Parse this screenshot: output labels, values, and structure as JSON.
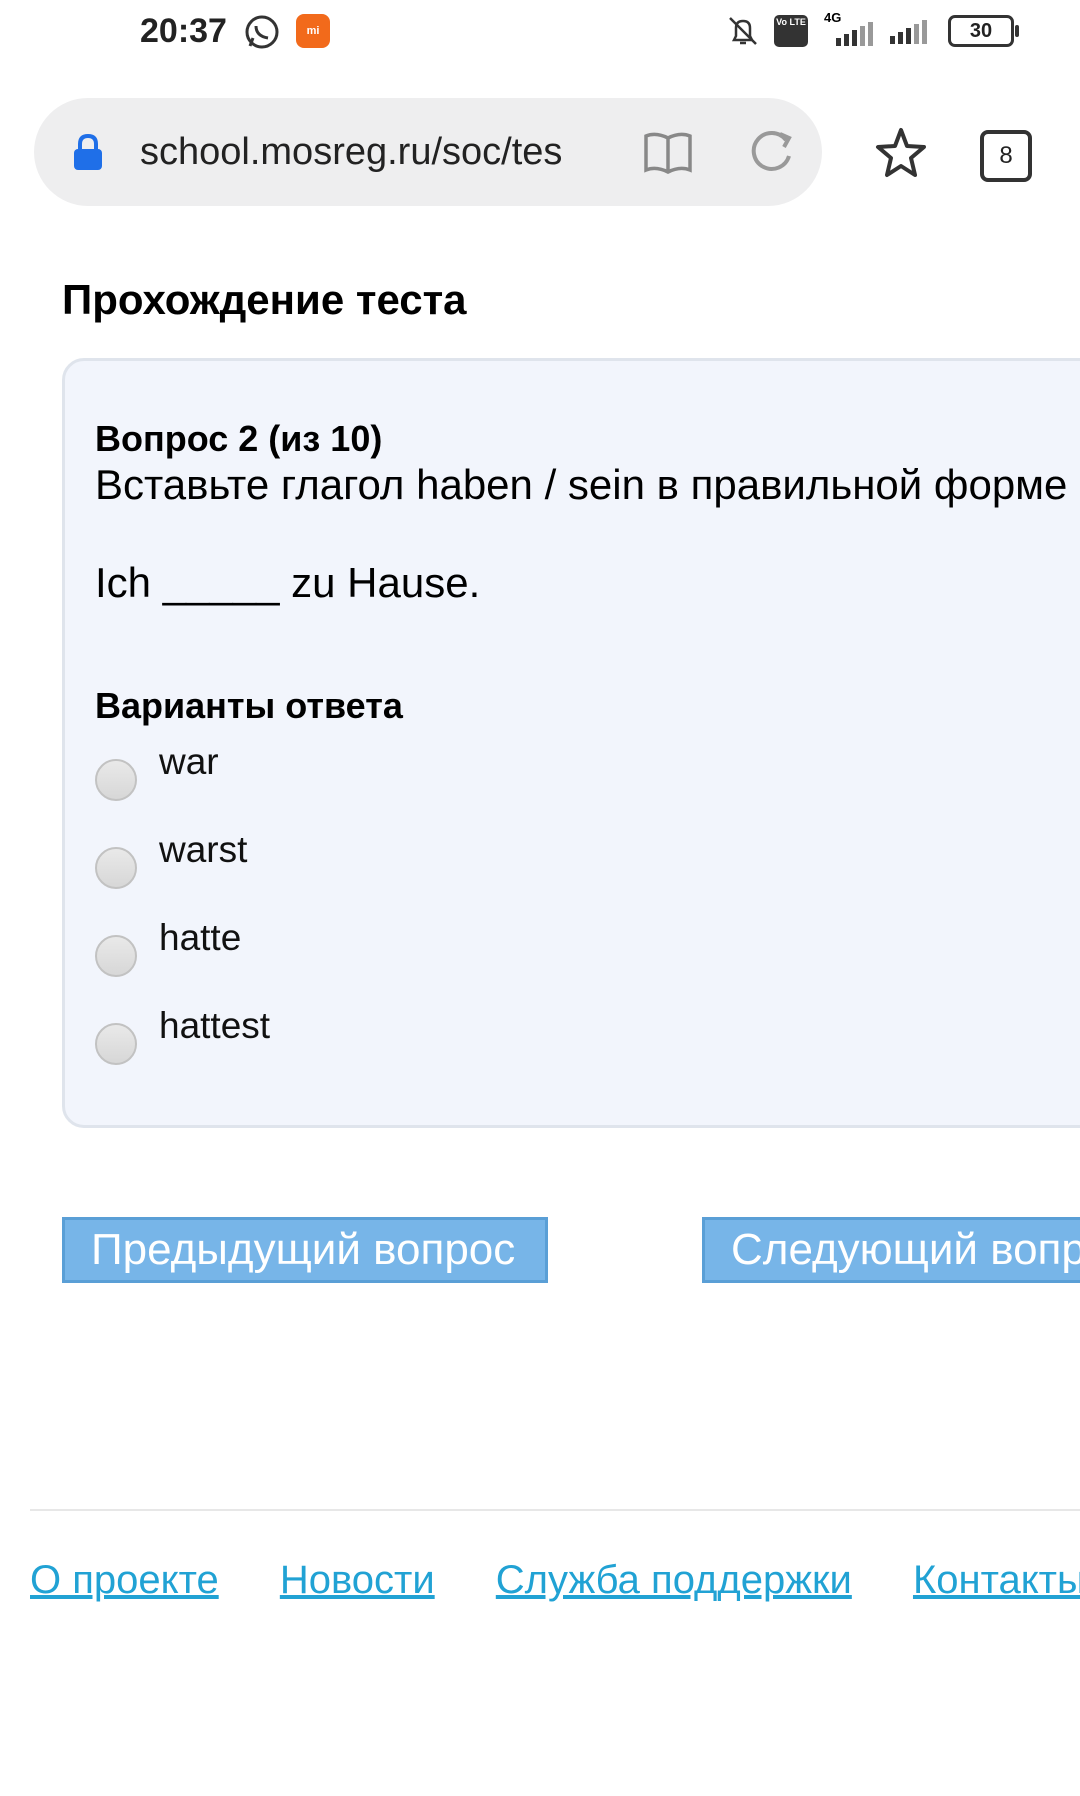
{
  "status_bar": {
    "time": "20:37",
    "network": "4G",
    "volte": "Vo LTE",
    "battery": "30",
    "icons": [
      "whatsapp-icon",
      "mi-app-icon",
      "bell-off-icon",
      "volte-icon",
      "signal-icon",
      "signal-icon",
      "battery-icon"
    ]
  },
  "browser": {
    "url": "school.mosreg.ru/soc/tes",
    "tab_count": "8",
    "icons": [
      "lock-icon",
      "reader-icon",
      "reload-icon",
      "star-icon",
      "tabs-icon"
    ]
  },
  "page": {
    "title": "Прохождение теста"
  },
  "question": {
    "number": "Вопрос 2 (из 10)",
    "instruction": "Вставьте глагол haben / sein в правильной форме",
    "sentence": "Ich _____ zu Hause."
  },
  "answers": {
    "title": "Варианты ответа",
    "options": [
      "war",
      "warst",
      "hatte",
      "hattest"
    ]
  },
  "nav": {
    "prev_label": "Предыдущий вопрос",
    "next_label": "Следующий вопрос"
  },
  "footer": {
    "links": [
      "О проекте",
      "Новости",
      "Служба поддержки",
      "Контакты"
    ]
  },
  "colors": {
    "button": "#77b5e8",
    "link": "#21a2d4",
    "card_bg": "#f2f5fc"
  }
}
